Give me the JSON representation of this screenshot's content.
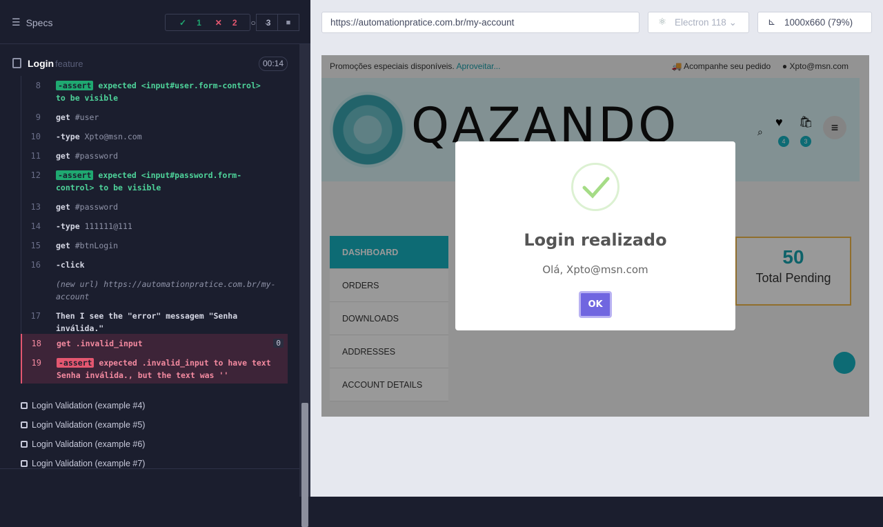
{
  "runner": {
    "specs_label": "Specs",
    "stats": {
      "passed": "1",
      "failed": "2",
      "pending": "3"
    },
    "suite": {
      "title": "Login",
      "type": "feature",
      "time": "00:14"
    },
    "commands": [
      {
        "num": "8",
        "name": "-assert",
        "text": "expected <input#user.form-control>",
        "text2": "to be visible"
      },
      {
        "num": "9",
        "name": "get",
        "sel": "#user"
      },
      {
        "num": "10",
        "name": "-type",
        "sel": "Xpto@msn.com"
      },
      {
        "num": "11",
        "name": "get",
        "sel": "#password"
      },
      {
        "num": "12",
        "name": "-assert",
        "text": "expected <input#password.form-",
        "text2": "control> to be visible"
      },
      {
        "num": "13",
        "name": "get",
        "sel": "#password"
      },
      {
        "num": "14",
        "name": "-type",
        "sel": "111111@111"
      },
      {
        "num": "15",
        "name": "get",
        "sel": "#btnLogin"
      },
      {
        "num": "16",
        "name": "-click"
      },
      {
        "num": "",
        "name": "(new url)",
        "sel": "https://automationpratice.com.br/my-",
        "sel2": "account"
      },
      {
        "num": "17",
        "name": "Then",
        "text": "I see the \"error\" messagem \"Senha",
        "text2": "inválida.\""
      },
      {
        "num": "18",
        "name": "get",
        "sel": ".invalid_input",
        "badge": "0"
      },
      {
        "num": "19",
        "name": "-assert",
        "text": "expected .invalid_input to have text",
        "text2": "Senha inválida., but the text was ''"
      }
    ],
    "tests": [
      "Login Validation (example #4)",
      "Login Validation (example #5)",
      "Login Validation (example #6)",
      "Login Validation (example #7)"
    ]
  },
  "browserbar": {
    "url": "https://automationpratice.com.br/my-account",
    "browser": "Electron 118",
    "viewport": "1000x660",
    "zoom": "(79%)"
  },
  "aut": {
    "promo": "Promoções especiais disponíveis.",
    "promo_link": "Aproveitar...",
    "track": "Acompanhe seu pedido",
    "user": "Xpto@msn.com",
    "brand": "QAZANDO",
    "wish_count": "4",
    "cart_count": "3",
    "menu": [
      "DASHBOARD",
      "ORDERS",
      "DOWNLOADS",
      "ADDRESSES",
      "ACCOUNT DETAILS"
    ],
    "pending_value": "50",
    "pending_label": "Total Pending",
    "modal": {
      "title": "Login realizado",
      "text": "Olá, Xpto@msn.com",
      "ok": "OK"
    }
  }
}
